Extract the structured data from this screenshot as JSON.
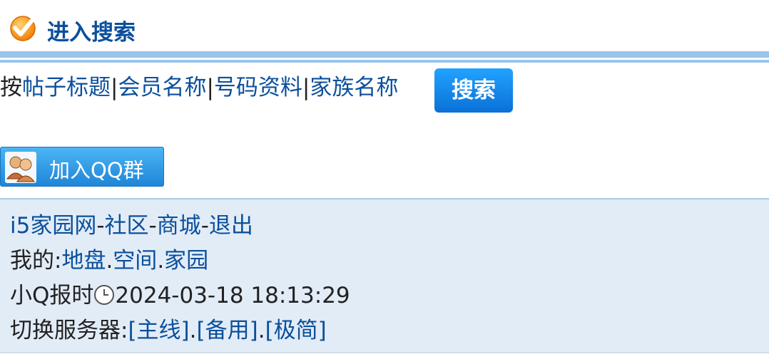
{
  "header": {
    "title": "进入搜索"
  },
  "search": {
    "prefix": "按",
    "links": [
      "帖子标题",
      "会员名称",
      "号码资料",
      "家族名称"
    ],
    "separator": "|",
    "button_label": "搜索"
  },
  "qq": {
    "label": "加入QQ群"
  },
  "footer": {
    "nav": [
      "i5家园网",
      "社区",
      "商城",
      "退出"
    ],
    "nav_sep": "-",
    "mine_prefix": "我的:",
    "mine_links": [
      "地盘",
      "空间",
      "家园"
    ],
    "dot": ".",
    "time_prefix": "小Q报时",
    "time_value": "2024-03-18 18:13:29",
    "server_prefix": "切换服务器:",
    "server_links": [
      "[主线]",
      "[备用]",
      "[极简]"
    ]
  },
  "colors": {
    "link": "#0b4f9c",
    "bar": "#99c4ec",
    "footer_bg": "#e2ecf7",
    "button": "#1689ea"
  },
  "icons": {
    "header": "check-icon",
    "qq": "qq-group-icon",
    "clock": "clock-icon"
  }
}
